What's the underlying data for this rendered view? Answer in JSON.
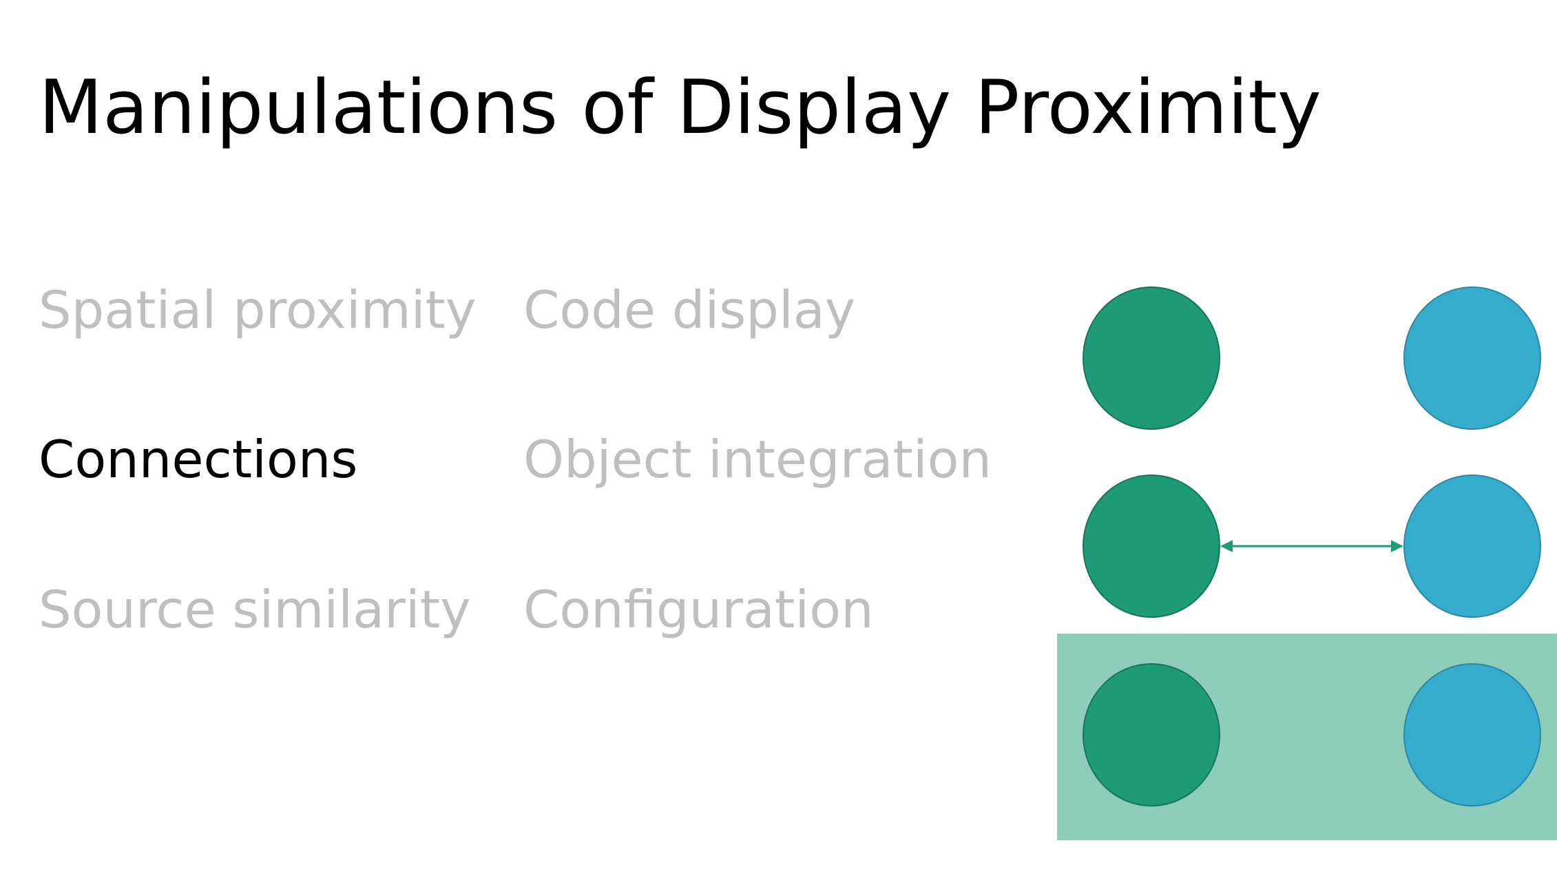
{
  "slide": {
    "title": "Manipulations of Display Proximity",
    "items": {
      "spatial": "Spatial proximity",
      "connections": "Connections",
      "source": "Source similarity",
      "code": "Code display",
      "object": "Object integration",
      "configuration": "Configuration"
    },
    "active_item": "Connections"
  },
  "diagram": {
    "colors": {
      "green": "#1e9a76",
      "green_stroke": "#17755a",
      "blue": "#36adcc",
      "blue_stroke": "#2a8aa5",
      "connector": "#1e9a76",
      "enclosure": "#8fcdbb",
      "inactive_text": "#bfbfbf",
      "active_text": "#000000"
    }
  }
}
